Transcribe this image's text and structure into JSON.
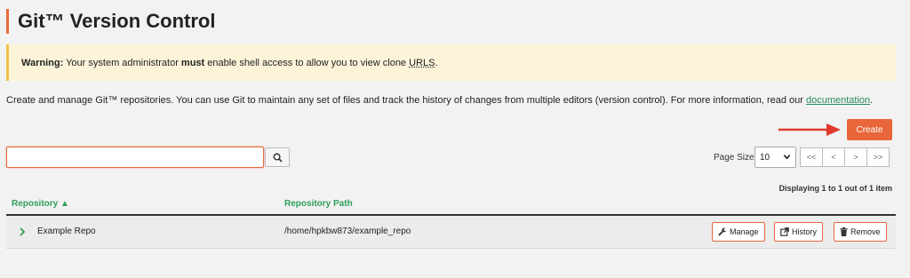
{
  "page": {
    "title": "Git™ Version Control"
  },
  "warning": {
    "label": "Warning:",
    "text_before": " Your system administrator ",
    "emphasis": "must",
    "text_after": " enable shell access to allow you to view clone ",
    "clone_urls": "URLS",
    "period": "."
  },
  "intro": {
    "text": "Create and manage Git™ repositories. You can use Git to maintain any set of files and track the history of changes from multiple editors (version control). For more information, read our ",
    "link": "documentation",
    "period": "."
  },
  "toolbar": {
    "create_label": "Create",
    "search_value": "",
    "search_icon": "search-icon"
  },
  "pagination": {
    "page_size_label": "Page Size",
    "page_size_value": "10",
    "first": "<<",
    "prev": "<",
    "next": ">",
    "last": ">>",
    "displaying": "Displaying 1 to 1 out of 1 item"
  },
  "table": {
    "columns": {
      "repository": "Repository",
      "path": "Repository Path"
    },
    "sort_indicator": "▲",
    "rows": [
      {
        "name": "Example Repo",
        "path": "/home/hpkbw873/example_repo",
        "actions": {
          "manage": "Manage",
          "history": "History",
          "remove": "Remove"
        }
      }
    ]
  },
  "colors": {
    "accent": "#e8663a",
    "link_green": "#2a8c5a",
    "header_green": "#2e9e5b",
    "warning_bg": "#fcf3d9",
    "arrow_red": "#e0392b"
  }
}
